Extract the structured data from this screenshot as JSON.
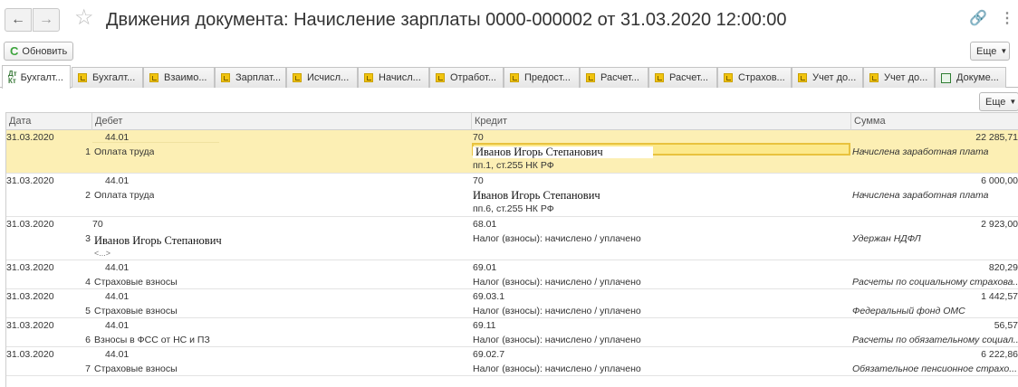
{
  "window": {
    "title": "Движения документа: Начисление зарплаты 0000-000002 от 31.03.2020 12:00:00",
    "back_icon": "arrow-left-icon",
    "forward_icon": "arrow-right-icon",
    "favorite_icon": "star-icon",
    "link_icon": "link-icon",
    "more_icon": "vertical-dots-icon"
  },
  "toolbar": {
    "refresh_label": "Обновить",
    "more_label": "Еще",
    "table_more_label": "Еще"
  },
  "tabs": [
    {
      "label": "Бухгалт...",
      "active": true
    },
    {
      "label": "Бухгалт..."
    },
    {
      "label": "Взаимо..."
    },
    {
      "label": "Зарплат..."
    },
    {
      "label": "Исчисл..."
    },
    {
      "label": "Начисл..."
    },
    {
      "label": "Отработ..."
    },
    {
      "label": "Предост..."
    },
    {
      "label": "Расчет..."
    },
    {
      "label": "Расчет..."
    },
    {
      "label": "Страхов..."
    },
    {
      "label": "Учет до..."
    },
    {
      "label": "Учет до..."
    },
    {
      "label": "Докуме..."
    }
  ],
  "table": {
    "columns": [
      "Дата",
      "Дебет",
      "Кредит",
      "Сумма"
    ],
    "rows": [
      {
        "date": "31.03.2020",
        "num": "1",
        "debit": "44.01",
        "debit_sub": "Оплата труда",
        "credit": "70",
        "credit_name": "Иванов Игорь Степанович",
        "credit_sub": "пп.1, ст.255 НК РФ",
        "amount": "22 285,71",
        "comment": "Начислена заработная плата"
      },
      {
        "date": "31.03.2020",
        "num": "2",
        "debit": "44.01",
        "debit_sub": "Оплата труда",
        "credit": "70",
        "credit_name": "Иванов Игорь Степанович",
        "credit_sub": "пп.6, ст.255 НК РФ",
        "amount": "6 000,00",
        "comment": "Начислена заработная плата"
      },
      {
        "date": "31.03.2020",
        "num": "3",
        "debit": "70",
        "debit_name": "Иванов Игорь Степанович",
        "debit_sub": "<...>",
        "credit": "68.01",
        "credit_sub": "Налог (взносы): начислено / уплачено",
        "amount": "2 923,00",
        "comment": "Удержан НДФЛ"
      },
      {
        "date": "31.03.2020",
        "num": "4",
        "debit": "44.01",
        "debit_sub": "Страховые взносы",
        "credit": "69.01",
        "credit_sub": "Налог (взносы): начислено / уплачено",
        "amount": "820,29",
        "comment": "Расчеты по социальному страхова..."
      },
      {
        "date": "31.03.2020",
        "num": "5",
        "debit": "44.01",
        "debit_sub": "Страховые взносы",
        "credit": "69.03.1",
        "credit_sub": "Налог (взносы): начислено / уплачено",
        "amount": "1 442,57",
        "comment": "Федеральный фонд ОМС"
      },
      {
        "date": "31.03.2020",
        "num": "6",
        "debit": "44.01",
        "debit_sub": "Взносы в ФСС от НС и ПЗ",
        "credit": "69.11",
        "credit_sub": "Налог (взносы): начислено / уплачено",
        "amount": "56,57",
        "comment": "Расчеты по обязательному социал..."
      },
      {
        "date": "31.03.2020",
        "num": "7",
        "debit": "44.01",
        "debit_sub": "Страховые взносы",
        "credit": "69.02.7",
        "credit_sub": "Налог (взносы): начислено / уплачено",
        "amount": "6 222,86",
        "comment": "Обязательное пенсионное страхо..."
      }
    ]
  }
}
